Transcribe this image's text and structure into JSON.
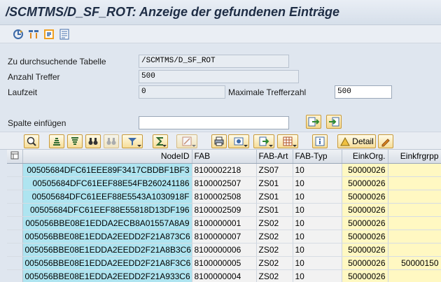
{
  "title": "/SCMTMS/D_SF_ROT: Anzeige der gefundenen Einträge",
  "toolbar": {
    "icons": [
      "execute-icon",
      "select-layout-icon",
      "display-icon",
      "print-list-icon"
    ]
  },
  "form": {
    "table_label": "Zu durchsuchende Tabelle",
    "table_value": "/SCMTMS/D_SF_ROT",
    "hits_label": "Anzahl Treffer",
    "hits_value": "500",
    "runtime_label": "Laufzeit",
    "runtime_value": "0",
    "max_hits_label": "Maximale Trefferzahl",
    "max_hits_value": "500",
    "insert_column_label": "Spalte einfügen",
    "insert_column_value": ""
  },
  "alv_toolbar": {
    "detail_label": "Detail"
  },
  "grid": {
    "columns": [
      "NodeID",
      "FAB",
      "FAB-Art",
      "FAB-Typ",
      "EinkOrg.",
      "Einkfrgrpp"
    ],
    "rows": [
      [
        "00505684DFC61EEE89F3417CBDBF1BF3",
        "8100002218",
        "ZS07",
        "10",
        "50000026",
        ""
      ],
      [
        "00505684DFC61EEF88E54FB260241186",
        "8100002507",
        "ZS01",
        "10",
        "50000026",
        ""
      ],
      [
        "00505684DFC61EEF88E5543A1030918F",
        "8100002508",
        "ZS01",
        "10",
        "50000026",
        ""
      ],
      [
        "00505684DFC61EEF88E55818D13DF196",
        "8100002509",
        "ZS01",
        "10",
        "50000026",
        ""
      ],
      [
        "005056BBE08E1EDDA2ECB8A01557A8A9",
        "8100000001",
        "ZS02",
        "10",
        "50000026",
        ""
      ],
      [
        "005056BBE08E1EDDA2EEDD2F21A873C6",
        "8100000007",
        "ZS02",
        "10",
        "50000026",
        ""
      ],
      [
        "005056BBE08E1EDDA2EEDD2F21A8B3C6",
        "8100000006",
        "ZS02",
        "10",
        "50000026",
        ""
      ],
      [
        "005056BBE08E1EDDA2EEDD2F21A8F3C6",
        "8100000005",
        "ZS02",
        "10",
        "50000026",
        "50000150"
      ],
      [
        "005056BBE08E1EDDA2EEDD2F21A933C6",
        "8100000004",
        "ZS02",
        "10",
        "50000026",
        ""
      ]
    ]
  }
}
